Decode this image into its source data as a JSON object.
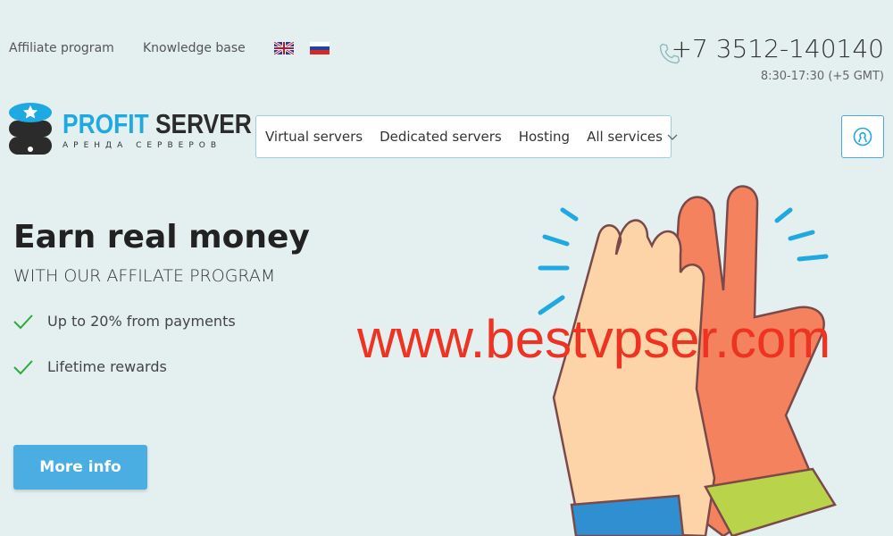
{
  "topbar": {
    "links": [
      "Affiliate program",
      "Knowledge base"
    ],
    "languages": [
      "English",
      "Russian"
    ],
    "phone": "+7 3512-140140",
    "hours": "8:30-17:30 (+5 GMT)"
  },
  "logo": {
    "name_part1": "PROFIT",
    "name_part2": "SERVER",
    "tagline": "АРЕНДА СЕРВЕРОВ"
  },
  "nav": {
    "items": [
      "Virtual servers",
      "Dedicated servers",
      "Hosting",
      "All services"
    ]
  },
  "hero": {
    "title": "Earn real money",
    "subtitle": "WITH OUR AFFILATE PROGRAM",
    "features": [
      "Up to 20% from payments",
      "Lifetime rewards"
    ],
    "button": "More info"
  },
  "watermark": "www.bestvpser.com",
  "colors": {
    "accent": "#1ea9e1",
    "button": "#4aaee3",
    "check": "#2bab3c",
    "background": "#e4eff0"
  }
}
